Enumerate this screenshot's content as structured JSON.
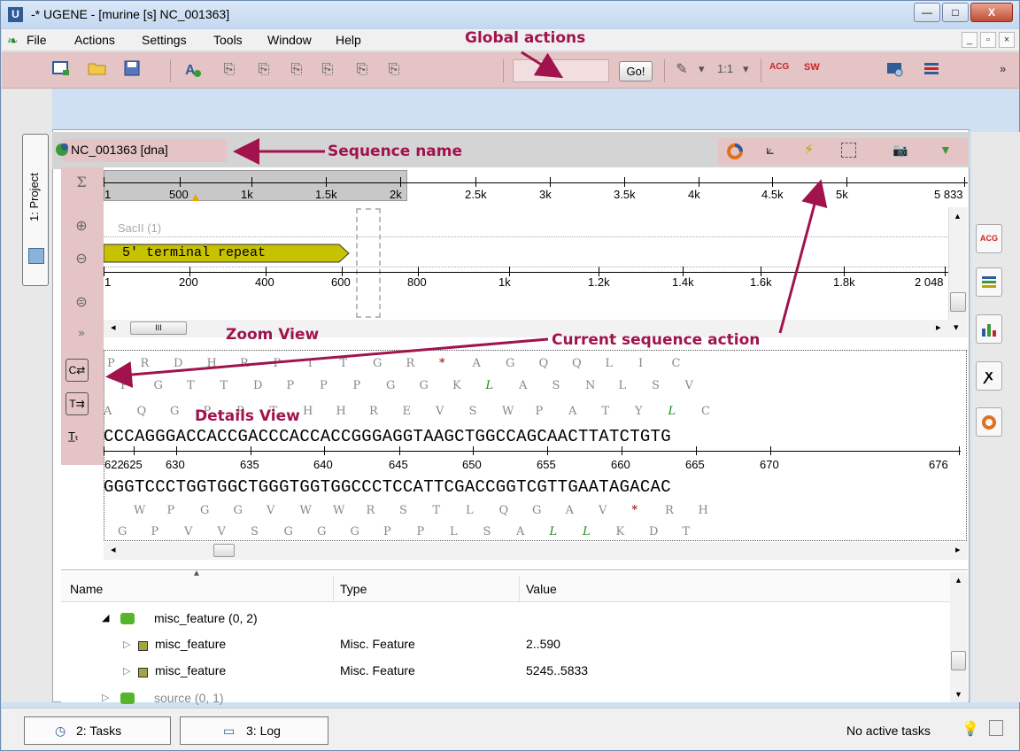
{
  "window": {
    "title": "-* UGENE - [murine [s] NC_001363]",
    "app_icon_letter": "U",
    "minimize": "—",
    "maximize": "□",
    "close": "X"
  },
  "menubar": {
    "items": [
      "File",
      "Actions",
      "Settings",
      "Tools",
      "Window",
      "Help"
    ],
    "mdi": [
      "_",
      "ð",
      "×"
    ]
  },
  "toolbar": {
    "search_placeholder": "",
    "go_label": "Go!",
    "zoom_ratio": "1:1",
    "acg_label": "ACG",
    "sw_label": "SW",
    "more": "»"
  },
  "project_tab": {
    "label": "1: Project"
  },
  "sequence": {
    "name": "NC_001363 [dna]"
  },
  "overview_ruler": {
    "labels": [
      "1",
      "500",
      "1k",
      "1.5k",
      "2k",
      "2.5k",
      "3k",
      "3.5k",
      "4k",
      "4.5k",
      "5k",
      "5 833"
    ]
  },
  "zoom_view": {
    "restriction_site": "SacII (1)",
    "annotation_label": "5' terminal repeat",
    "ruler_labels": [
      "1",
      "200",
      "400",
      "600",
      "800",
      "1k",
      "1.2k",
      "1.4k",
      "1.6k",
      "1.8k",
      "2 048"
    ],
    "scroll_thumb_label": "III"
  },
  "details_view": {
    "aa_frame_1": [
      "P",
      "R",
      "D",
      "H",
      "R",
      "P",
      "T",
      "T",
      "G",
      "R",
      "*",
      "A",
      "G",
      "Q",
      "Q",
      "L",
      "I",
      "C"
    ],
    "aa_frame_2": [
      "P",
      "G",
      "T",
      "T",
      "D",
      "P",
      "P",
      "P",
      "G",
      "G",
      "K",
      "L",
      "A",
      "S",
      "N",
      "L",
      "S",
      "V"
    ],
    "aa_frame_3": [
      "A",
      "Q",
      "G",
      "P",
      "P",
      "T",
      "H",
      "H",
      "R",
      "E",
      "V",
      "S",
      "W",
      "P",
      "A",
      "T",
      "Y",
      "L",
      "C"
    ],
    "dna_forward": "CCCAGGGACCACCGACCCACCACCGGGAGGTAAGCTGGCCAGCAACTTATCTGTG",
    "ruler_labels": [
      "622",
      "625",
      "630",
      "635",
      "640",
      "645",
      "650",
      "655",
      "660",
      "665",
      "670",
      "676"
    ],
    "dna_reverse": "GGGTCCCTGGTGGCTGGGTGGTGGCCCTCCATTCGACCGGTCGTTGAATAGACAC",
    "aa_rev_1": [
      "W",
      "P",
      "G",
      "G",
      "V",
      "W",
      "W",
      "R",
      "S",
      "T",
      "L",
      "Q",
      "G",
      "A",
      "V",
      "*",
      "R",
      "H"
    ],
    "aa_rev_2": [
      "G",
      "P",
      "V",
      "V",
      "S",
      "G",
      "G",
      "G",
      "P",
      "P",
      "L",
      "S",
      "A",
      "L",
      "L",
      "K",
      "D",
      "T"
    ]
  },
  "annotations": {
    "columns": [
      "Name",
      "Type",
      "Value"
    ],
    "group": "misc_feature  (0, 2)",
    "rows": [
      {
        "name": "misc_feature",
        "type": "Misc. Feature",
        "value": "2..590"
      },
      {
        "name": "misc_feature",
        "type": "Misc. Feature",
        "value": "5245..5833"
      }
    ],
    "source_group": "source  (0, 1)"
  },
  "statusbar": {
    "tasks_tab": "2: Tasks",
    "log_tab": "3: Log",
    "status_text": "No active tasks"
  },
  "callouts": {
    "global_actions": "Global actions",
    "sequence_name": "Sequence name",
    "zoom_view": "Zoom View",
    "current_sequence_action": "Current sequence action",
    "details_view": "Details View"
  },
  "colors": {
    "highlight": "#e4c4c4",
    "callout": "#a1134d",
    "annotation_fill": "#c7c200"
  }
}
